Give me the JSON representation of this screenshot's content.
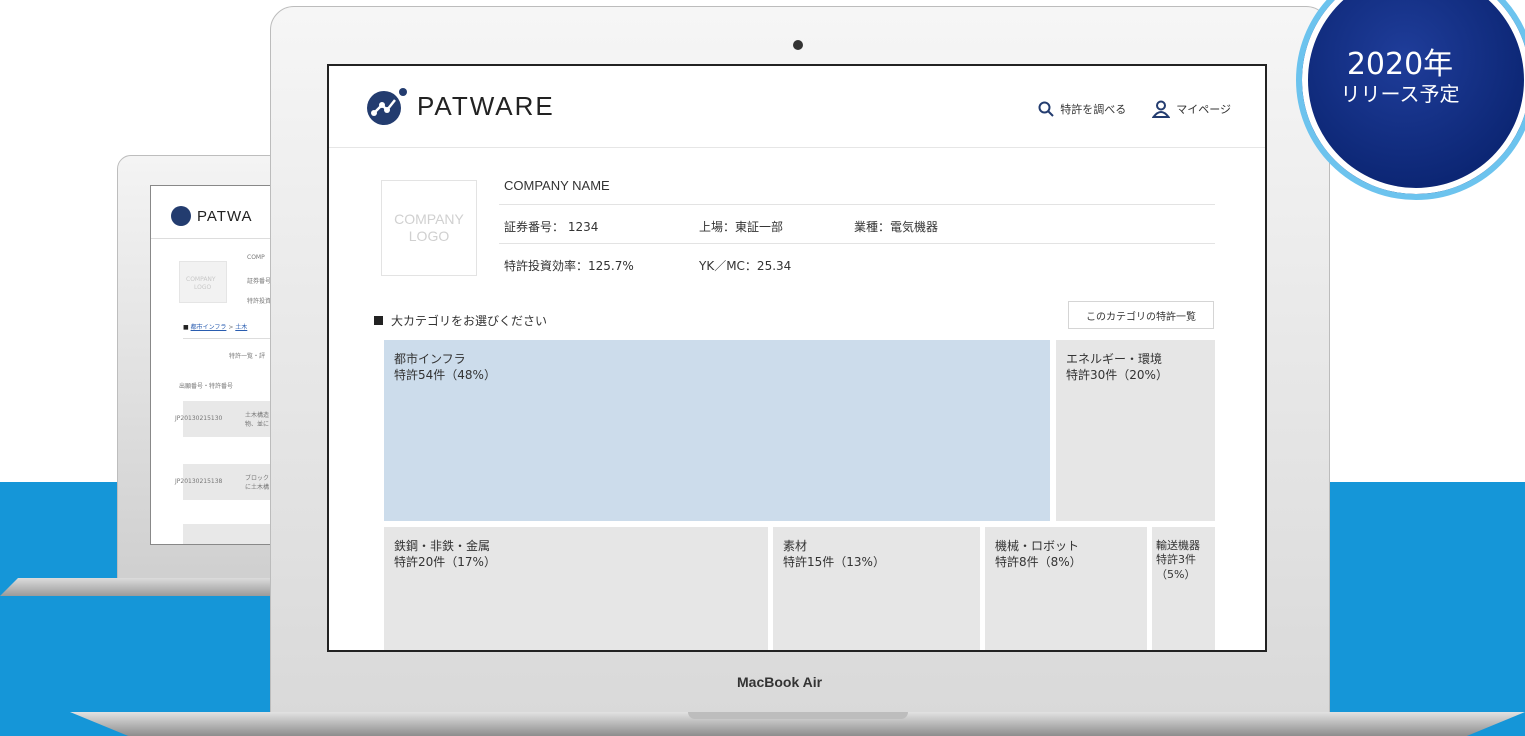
{
  "front": {
    "brand": "PATWARE",
    "nav": [
      {
        "icon": "search-icon",
        "label": "特許を調べる"
      },
      {
        "icon": "user-icon",
        "label": "マイページ"
      }
    ],
    "company": {
      "logo_line1": "COMPANY",
      "logo_line2": "LOGO",
      "name": "COMPANY NAME",
      "security_code": "証券番号： 1234",
      "listing": "上場：東証一部",
      "industry": "業種：電気機器",
      "patent_efficiency": "特許投資効率：125.7%",
      "yk_mc": "YK／MC：25.34"
    },
    "category_heading": "大カテゴリをお選びください",
    "category_button": "このカテゴリの特許一覧",
    "categories": [
      {
        "name": "都市インフラ",
        "count": "特許54件（48%）",
        "color": "#ccdceb"
      },
      {
        "name": "エネルギー・環境",
        "count": "特許30件（20%）",
        "color": "#e6e6e6"
      },
      {
        "name": "鉄鋼・非鉄・金属",
        "count": "特許20件（17%）",
        "color": "#e6e6e6"
      },
      {
        "name": "素材",
        "count": "特許15件（13%）",
        "color": "#e6e6e6"
      },
      {
        "name": "機械・ロボット",
        "count": "特許8件（8%）",
        "color": "#e6e6e6"
      },
      {
        "name": "輸送機器",
        "count": "特許3件",
        "count2": "（5%）",
        "color": "#e6e6e6"
      }
    ]
  },
  "back": {
    "brand": "PATWA",
    "company_partial": "COMP",
    "logo_line1": "COMPANY",
    "logo_line2": "LOGO",
    "row1": "証券番号",
    "row2": "特許投資",
    "breadcrumb_home": "都市インフラ",
    "breadcrumb_sep": ">",
    "breadcrumb_next": "土木",
    "tab": "特許一覧・評",
    "col_header": "出願番号・特許番号",
    "rows": [
      {
        "id": "JP20130215130",
        "text1": "土木構造",
        "text2": "物、並に"
      },
      {
        "id": "JP20130215138",
        "text1": "ブロック",
        "text2": "に土木構"
      }
    ]
  },
  "device_label": "MacBook Air",
  "badge": {
    "year": "2020年",
    "sub": "リリース予定"
  },
  "colors": {
    "brand_mark": "#233c6f",
    "band": "#1596d8",
    "badge": "#0c2674",
    "highlight": "#ccdceb"
  }
}
